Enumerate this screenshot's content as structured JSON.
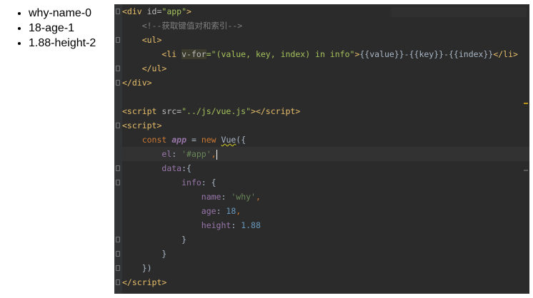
{
  "output_list": [
    "why-name-0",
    "18-age-1",
    "1.88-height-2"
  ],
  "editor": {
    "comment_text": "<!--获取键值对和索引-->",
    "app_id": "\"app\"",
    "vfor_attr": "v-for",
    "vfor_value": "=\"(value, key, index) in info\"",
    "interp_text": "{{value}}-{{key}}-{{index}}",
    "script_src": "\"../js/vue.js\"",
    "el_value": "'#app'",
    "info_name": "'why'",
    "info_age": "18",
    "info_height": "1.88"
  },
  "colors": {
    "editor_bg": "#2b2b2b",
    "tag": "#e8bf6a",
    "string": "#a5c25c",
    "keyword": "#cc7832",
    "property": "#9876aa",
    "number": "#6897bb"
  }
}
